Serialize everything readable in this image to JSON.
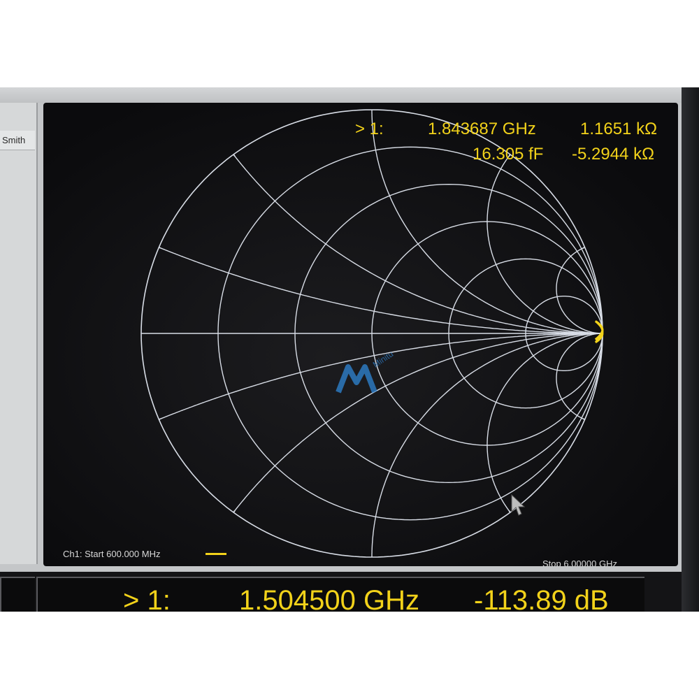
{
  "sidebar": {
    "tab_label": "Smith"
  },
  "marker": {
    "label": "> 1:",
    "frequency": "1.843687 GHz",
    "resistance": "1.1651 kΩ",
    "capacitance": "16.305 fF",
    "reactance": "-5.2944 kΩ"
  },
  "footer": {
    "start": "Ch1: Start  600.000 MHz",
    "stop": "Stop  6.00000 GHz"
  },
  "readout": {
    "label": "> 1:",
    "frequency": "1.504500 GHz",
    "value": "-113.89 dB"
  },
  "watermark": {
    "text": "Minitu"
  },
  "colors": {
    "trace": "#f2d21a",
    "grid": "#d8dde6",
    "screen": "#0f0f11"
  },
  "icons": {
    "cursor": "mouse-pointer-icon",
    "watermark": "watermark-logo-icon"
  }
}
